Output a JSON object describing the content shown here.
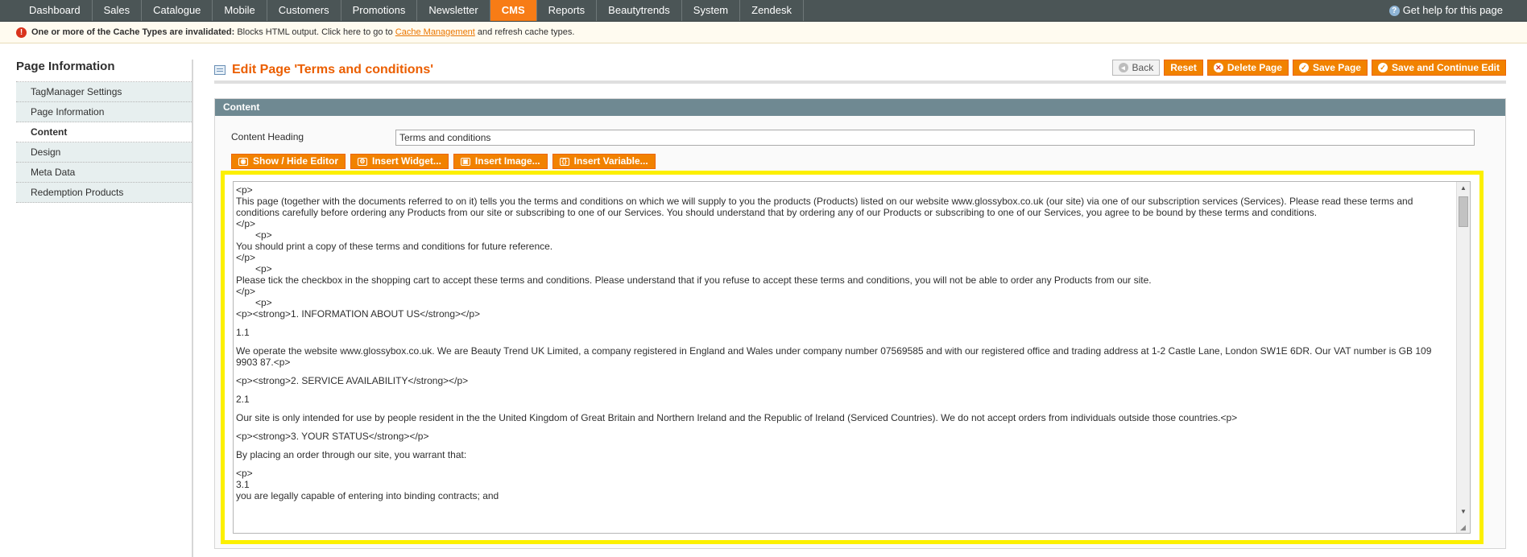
{
  "nav": {
    "items": [
      "Dashboard",
      "Sales",
      "Catalogue",
      "Mobile",
      "Customers",
      "Promotions",
      "Newsletter",
      "CMS",
      "Reports",
      "Beautytrends",
      "System",
      "Zendesk"
    ],
    "active": "CMS",
    "help": "Get help for this page"
  },
  "notice": {
    "strong": "One or more of the Cache Types are invalidated:",
    "text1": "Blocks HTML output. Click here to go to",
    "link": "Cache Management",
    "text2": "and refresh cache types."
  },
  "sidebar": {
    "title": "Page Information",
    "items": [
      "TagManager Settings",
      "Page Information",
      "Content",
      "Design",
      "Meta Data",
      "Redemption Products"
    ],
    "active": "Content"
  },
  "page": {
    "title": "Edit Page 'Terms and conditions'",
    "buttons": {
      "back": "Back",
      "reset": "Reset",
      "delete": "Delete Page",
      "save": "Save Page",
      "save_continue": "Save and Continue Edit"
    }
  },
  "content": {
    "section_title": "Content",
    "heading_label": "Content Heading",
    "heading_value": "Terms and conditions",
    "editor_buttons": [
      "Show / Hide Editor",
      "Insert Widget...",
      "Insert Image...",
      "Insert Variable..."
    ],
    "lines": [
      "<p>",
      "This page (together with the documents referred to on it) tells you the terms and conditions on which we will supply to you the products (Products) listed on our website www.glossybox.co.uk (our site) via one of our subscription services (Services). Please read these terms and",
      "conditions carefully before ordering any Products from our site or subscribing to one of our Services. You should understand that by ordering any of our Products or subscribing to one of our Services, you agree to be bound by these terms and conditions.",
      "</p>",
      "<p>",
      "You should print a copy of these terms and conditions for future reference.",
      "</p>",
      "<p>",
      "Please tick the checkbox in the shopping cart to accept these terms and conditions. Please understand that if you refuse to accept these terms and conditions, you will not be able to order any Products from our site.",
      "</p>",
      "<p>",
      "<p><strong>1. INFORMATION ABOUT US</strong></p>",
      "",
      "1.1",
      "",
      "We operate the website www.glossybox.co.uk. We are Beauty Trend UK Limited, a company registered in England and Wales under company number 07569585 and with our registered office and trading address at 1-2 Castle Lane, London SW1E 6DR. Our VAT number is GB 109",
      "9903 87.<p>",
      "",
      "<p><strong>2. SERVICE AVAILABILITY</strong></p>",
      "",
      "2.1",
      "",
      "Our site is only intended for use by people resident in the the United Kingdom of Great Britain and Northern Ireland and the Republic of Ireland (Serviced Countries). We do not accept orders from individuals outside those countries.<p>",
      "",
      "<p><strong>3. YOUR STATUS</strong></p>",
      "",
      "By placing an order through our site, you warrant that:",
      "",
      "<p>",
      "3.1",
      "you are legally capable of entering into binding contracts; and"
    ]
  },
  "colors": {
    "accent": "#f18200",
    "nav_bg": "#4b5556",
    "title": "#eb5e00",
    "highlight": "#fcf000",
    "section_head": "#6f8992"
  }
}
